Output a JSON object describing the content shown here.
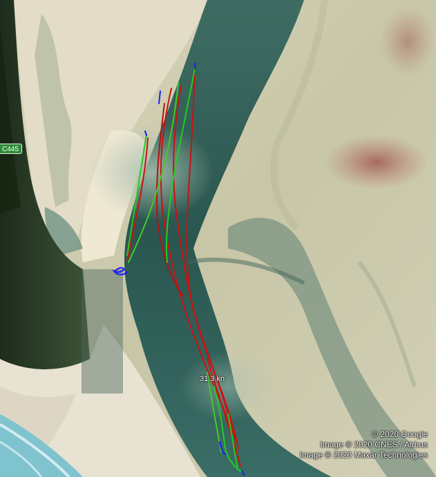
{
  "map": {
    "road_label": "C445",
    "speed_label": "31.3 kn",
    "attribution": [
      "© 2020 Google",
      "Image © 2020 CNES / Airbus",
      "Image © 2020 Maxar Technologies"
    ],
    "track_colors": {
      "slow": "#1a1aff",
      "medium": "#22cc22",
      "fast": "#cc1111"
    },
    "terrain_colors": {
      "forest": "#2c3f2a",
      "sand": "#e6dfcc",
      "flats": "#c9c7a8",
      "deep_channel": "#2d5752",
      "shallow_water": "#8fa89a",
      "ocean": "#7fc3cf"
    }
  }
}
